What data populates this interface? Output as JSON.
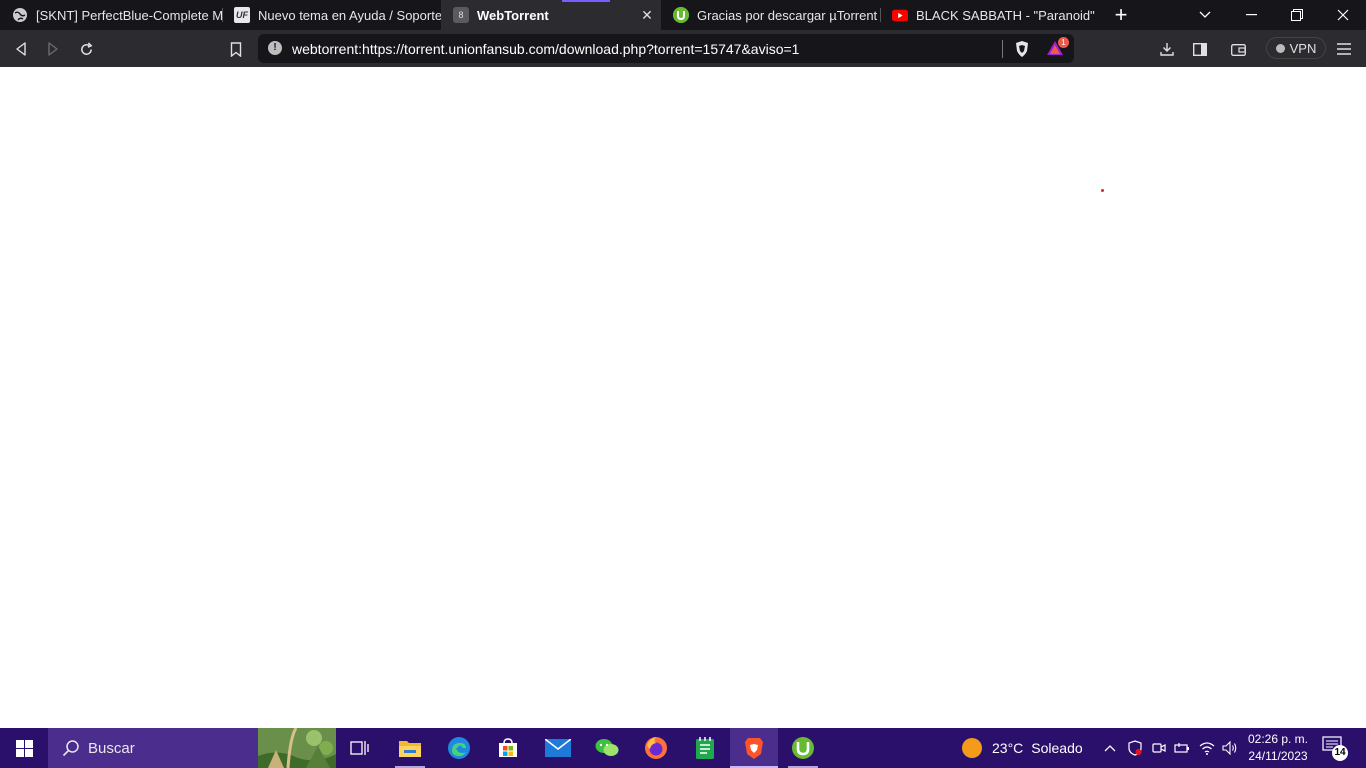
{
  "browser": {
    "tabs": [
      {
        "title": "[SKNT] PerfectBlue-Complete Meta",
        "favicon": "globe-icon",
        "active": false
      },
      {
        "title": "Nuevo tema en Ayuda / Soporte",
        "favicon": "uf-icon",
        "favicon_text": "UF",
        "active": false
      },
      {
        "title": "WebTorrent",
        "favicon": "webtorrent-icon",
        "favicon_text": "8",
        "active": true
      },
      {
        "title": "Gracias por descargar µTorrent (uT",
        "favicon": "utorrent-icon",
        "active": false
      },
      {
        "title": "BLACK SABBATH - \"Paranoid\" (Offi",
        "favicon": "youtube-icon",
        "active": false
      }
    ],
    "url": "webtorrent:https://torrent.unionfansub.com/download.php?torrent=15747&aviso=1",
    "rewards_badge": "1",
    "vpn_label": "VPN",
    "accent_color": "#7b5cff"
  },
  "taskbar": {
    "search_placeholder": "Buscar",
    "apps": [
      "task-view-icon",
      "file-explorer-icon",
      "edge-icon",
      "microsoft-store-icon",
      "mail-icon",
      "wechat-icon",
      "firefox-icon",
      "notepad-icon",
      "brave-icon",
      "utorrent-icon"
    ],
    "weather": {
      "temp": "23°C",
      "condition": "Soleado"
    },
    "clock": {
      "time": "02:26 p. m.",
      "date": "24/11/2023"
    },
    "notification_count": "14",
    "color": "#2a0f6b"
  }
}
